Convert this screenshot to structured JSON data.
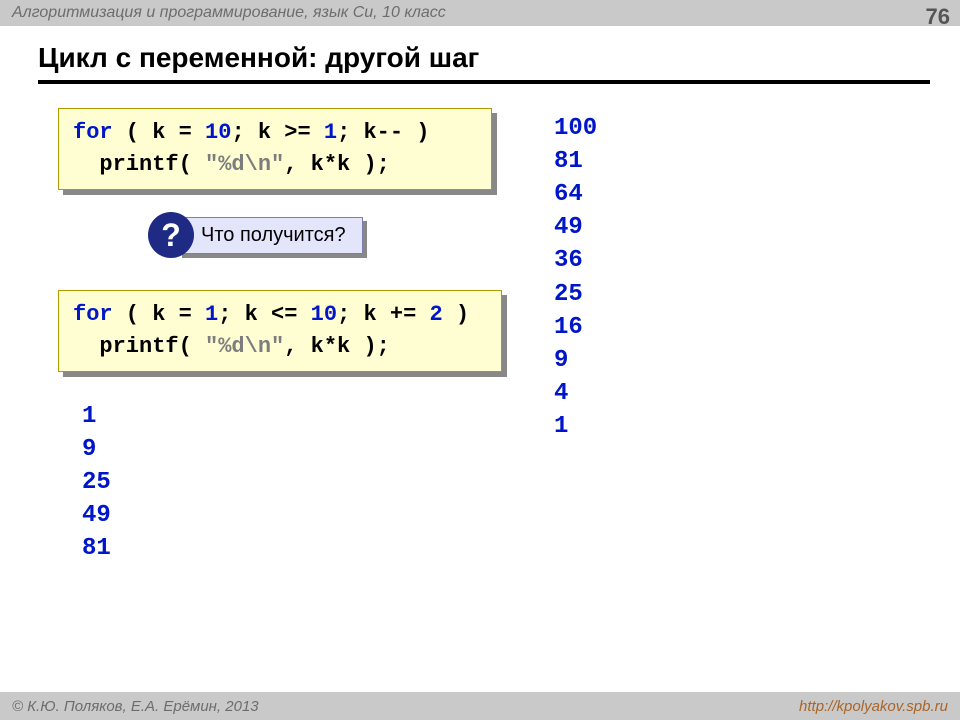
{
  "header": {
    "subject": "Алгоритмизация и программирование, язык Си, 10 класс",
    "page_number": "76"
  },
  "title": "Цикл с переменной: другой шаг",
  "code1": {
    "kw_for": "for",
    "t1": " ( k ",
    "op1": "=",
    "t1b": " ",
    "n1": "10",
    "t2": "; k ",
    "op2": ">=",
    "t2b": " ",
    "n2": "1",
    "t3": "; k",
    "op3": "--",
    "t4": " )",
    "l2a": "  printf( ",
    "str": "\"%d\\n\"",
    "l2b": ", k*k );"
  },
  "question": {
    "mark": "?",
    "text": "Что получится?"
  },
  "code2": {
    "kw_for": "for",
    "t1": " ( k ",
    "op1": "=",
    "t1b": " ",
    "n1": "1",
    "t2": "; k ",
    "op2": "<=",
    "t2b": " ",
    "n2": "10",
    "t3": "; k ",
    "op3": "+=",
    "t3b": " ",
    "n3": "2",
    "t4": " )",
    "l2a": "  printf( ",
    "str": "\"%d\\n\"",
    "l2b": ", k*k );"
  },
  "output_right": "100\n81\n64\n49\n36\n25\n16\n9\n4\n1",
  "output_left": "1\n9\n25\n49\n81",
  "footer": {
    "authors": "© К.Ю. Поляков, Е.А. Ерёмин, 2013",
    "url": "http://kpolyakov.spb.ru"
  }
}
